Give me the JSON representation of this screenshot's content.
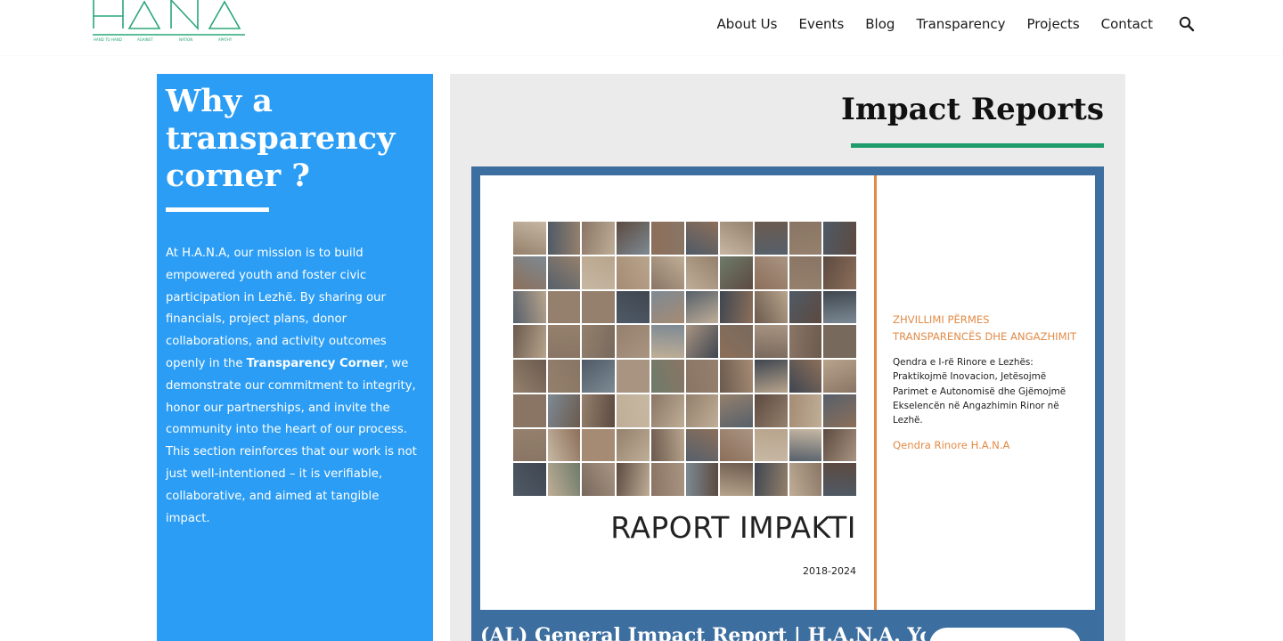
{
  "header": {
    "logo_alt": "H.A.N.A",
    "nav": [
      {
        "label": "About Us"
      },
      {
        "label": "Events"
      },
      {
        "label": "Blog"
      },
      {
        "label": "Transparency"
      },
      {
        "label": "Projects"
      },
      {
        "label": "Contact"
      }
    ],
    "search_icon": "search-icon"
  },
  "why": {
    "title": "Why a transparency corner ?",
    "paragraph_before": "At H.A.N.A, our mission is to build empowered youth and foster civic participation in Lezhë. By sharing our financials, project plans, donor collaborations, and activity outcomes openly in the ",
    "paragraph_bold": "Transparency Corner",
    "paragraph_after": ", we demonstrate our commitment to integrity, honor our partnerships, and invite the community into the heart of our process. This section reinforces that our work is not just well-intentioned – it is verifiable, collaborative, and aimed at tangible impact."
  },
  "reports": {
    "title": "Impact Reports",
    "card": {
      "cover_title": "RAPORT IMPAKTI",
      "cover_years": "2018-2024",
      "side_heading": "ZHVILLIMI PËRMES TRANSPARENCËS DHE ANGAZHIMIT",
      "side_description": "Qendra e I-rë Rinore e Lezhës: Praktikojmë Inovacion, Jetësojmë Parimet e Autonomisë dhe Gjëmojmë Ekselencën në Angazhimin Rinor në Lezhë.",
      "side_org": "Qendra Rinore H.A.N.A",
      "title": "(AL) General Impact Report | H.A.N.A. Youth"
    }
  },
  "colors": {
    "accent_blue": "#2b9df5",
    "green_rule": "#1f9c6b",
    "card_border": "#3c6e9f",
    "cover_orange": "#e28b46"
  }
}
